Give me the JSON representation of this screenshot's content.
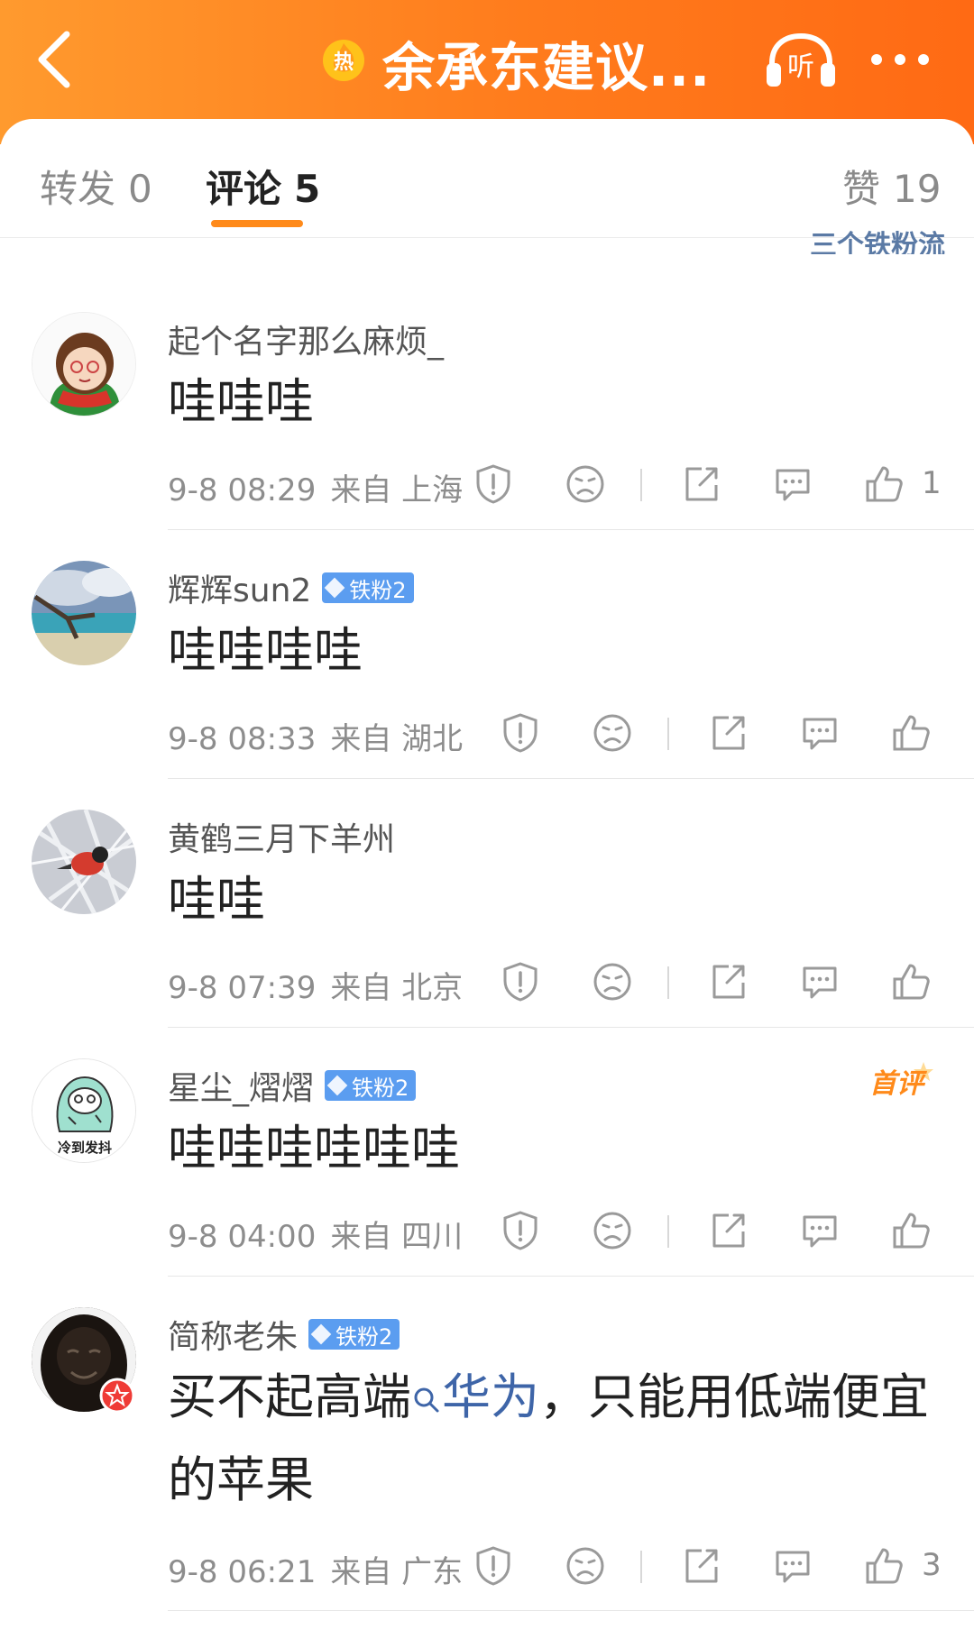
{
  "header": {
    "title": "余承东建议...",
    "hot_label": "热",
    "listen_label": "听"
  },
  "tabs": [
    {
      "label": "转发",
      "count": "0"
    },
    {
      "label": "评论",
      "count": "5"
    },
    {
      "label": "赞",
      "count": "19"
    }
  ],
  "cut_text": "三个铁粉流",
  "comments": [
    {
      "username": "起个名字那么麻烦_",
      "badge": "",
      "text": "哇哇哇",
      "time": "9-8 08:29",
      "location": "来自 上海",
      "likes": "1"
    },
    {
      "username": "辉辉sun2",
      "badge": "铁粉2",
      "text": "哇哇哇哇",
      "time": "9-8 08:33",
      "location": "来自 湖北",
      "likes": ""
    },
    {
      "username": "黄鹤三月下羊州",
      "badge": "",
      "text": "哇哇",
      "time": "9-8 07:39",
      "location": "来自 北京",
      "likes": ""
    },
    {
      "username": "星尘_熠熠",
      "badge": "铁粉2",
      "text": "哇哇哇哇哇哇",
      "time": "9-8 04:00",
      "location": "来自 四川",
      "likes": "",
      "first_comment": "首评",
      "avatar_caption": "冷到发抖"
    },
    {
      "username": "简称老朱",
      "badge": "铁粉2",
      "text_before": "买不起高端",
      "topic": "华为",
      "text_after": "，只能用低端便宜的苹果",
      "time": "9-8 06:21",
      "location": "来自 广东",
      "likes": "3"
    }
  ],
  "colors": {
    "header_orange": "#ff7b1c",
    "tab_underline": "#ff8a1a",
    "fan_badge": "#5b9df0",
    "topic_link": "#3e65a8"
  }
}
